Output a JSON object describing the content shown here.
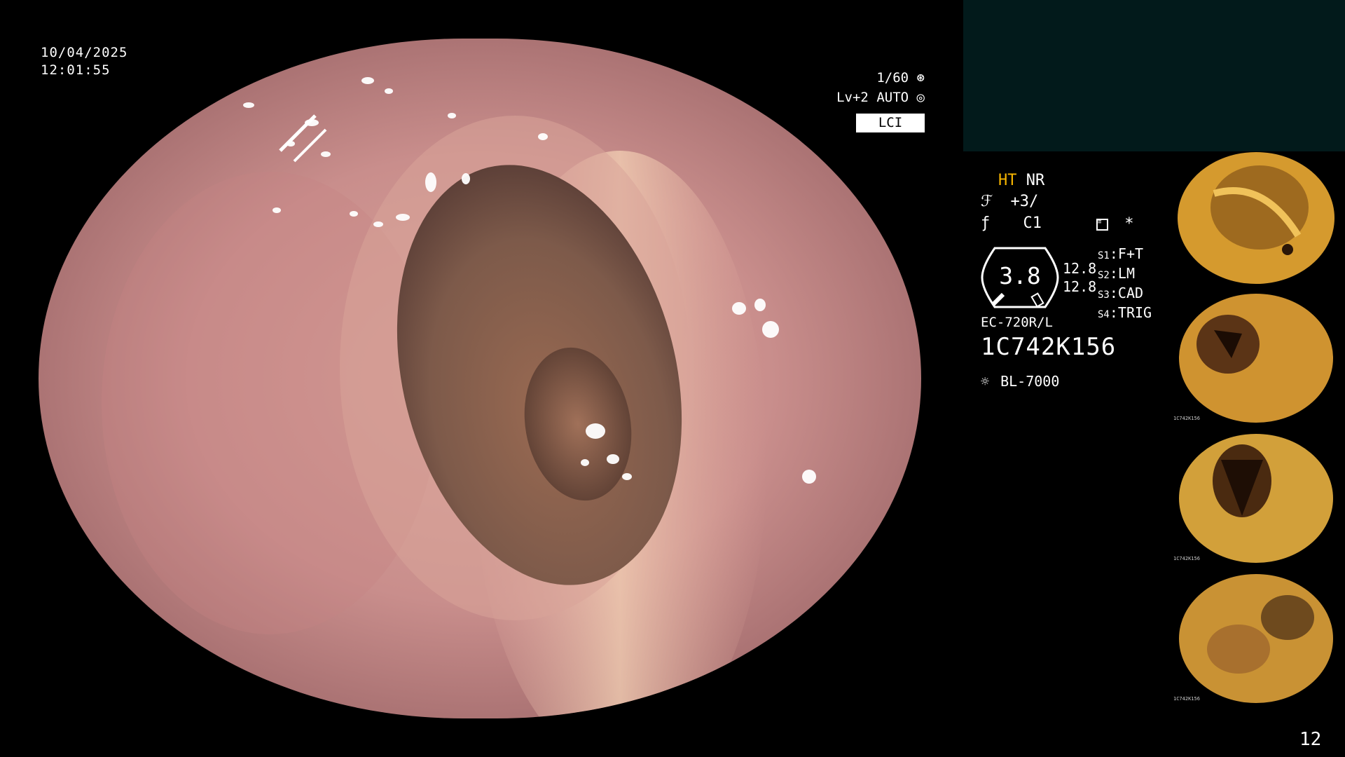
{
  "datetime": {
    "date": "10/04/2025",
    "time": "12:01:55"
  },
  "exposure": {
    "shutter": "1/60",
    "level": "Lv+2",
    "mode": "AUTO",
    "mode_label": "LCI"
  },
  "settings": {
    "ht_label": "HT",
    "nr_label": "NR",
    "enhance": "+3/",
    "color": "C1",
    "star": "*",
    "zoom_value": "3.8",
    "value_a": "12.8",
    "value_b": "12.8",
    "switches": [
      {
        "key": "S1",
        "label": "F+T"
      },
      {
        "key": "S2",
        "label": "LM"
      },
      {
        "key": "S3",
        "label": "CAD"
      },
      {
        "key": "S4",
        "label": "TRIG"
      }
    ]
  },
  "scope": {
    "model": "EC-720R/L",
    "serial": "1C742K156",
    "light_source": "BL-7000"
  },
  "page_number": "12",
  "thumbnails": [
    {
      "serial": "",
      "tone": "#c8921c"
    },
    {
      "serial": "1C742K156",
      "tone": "#c48a2a"
    },
    {
      "serial": "1C742K156",
      "tone": "#c39228"
    },
    {
      "serial": "1C742K156",
      "tone": "#bb8a30"
    }
  ],
  "colors": {
    "ht_accent": "#f5b400",
    "panel": "#021a1b"
  }
}
